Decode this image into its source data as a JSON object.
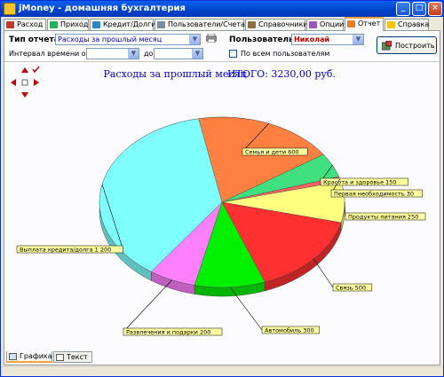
{
  "window": {
    "title": "jMoney - домашняя бухгалтерия"
  },
  "tabs": [
    {
      "label": "Расход",
      "icon": "expense-icon",
      "color": "#C0392B"
    },
    {
      "label": "Приход",
      "icon": "income-icon",
      "color": "#27AE60"
    },
    {
      "label": "Кредит/Долги",
      "icon": "credit-icon",
      "color": "#2E86C1"
    },
    {
      "label": "Пользователи/Счета",
      "icon": "users-icon",
      "color": "#7D8C9C"
    },
    {
      "label": "Справочники",
      "icon": "book-icon",
      "color": "#8E6E3A"
    },
    {
      "label": "Опции",
      "icon": "options-icon",
      "color": "#9B59B6"
    },
    {
      "label": "Отчет",
      "icon": "report-icon",
      "color": "#E67E22"
    },
    {
      "label": "Справка",
      "icon": "help-icon",
      "color": "#F1C40F"
    }
  ],
  "filters": {
    "report_type_label": "Тип отчета:",
    "report_type_value": "Расходы за прошлый месяц",
    "interval_label": "Интервал времени от",
    "interval_from_value": "",
    "interval_to_label": "до",
    "interval_to_value": "",
    "user_label": "Пользователь:",
    "user_value": "Николай",
    "all_users_label": "По всем пользователям",
    "build_button": "Построить"
  },
  "chart_data": {
    "type": "pie",
    "title": "Расходы за прошлый месяц",
    "total": "ИТОГО: 3230,00 руб.",
    "slices": [
      {
        "label": "Семья и дети 600",
        "value": 600,
        "color": "#FF8040"
      },
      {
        "label": "Красота и здоровье 150",
        "value": 150,
        "color": "#40E080"
      },
      {
        "label": "Первая необходимость 30",
        "value": 30,
        "color": "#FF6060"
      },
      {
        "label": "Продукты питания 250",
        "value": 250,
        "color": "#FFFF80"
      },
      {
        "label": "Связь 500",
        "value": 500,
        "color": "#FF3030"
      },
      {
        "label": "Автомобиль 300",
        "value": 300,
        "color": "#00F000"
      },
      {
        "label": "Развлечения и подарки 200",
        "value": 200,
        "color": "#FF80FF"
      },
      {
        "label": "Выплата кредита/долга 1 200",
        "value": 1200,
        "color": "#80FFFF"
      }
    ]
  },
  "bottom_tabs": [
    {
      "label": "Графика"
    },
    {
      "label": "Текст"
    }
  ]
}
